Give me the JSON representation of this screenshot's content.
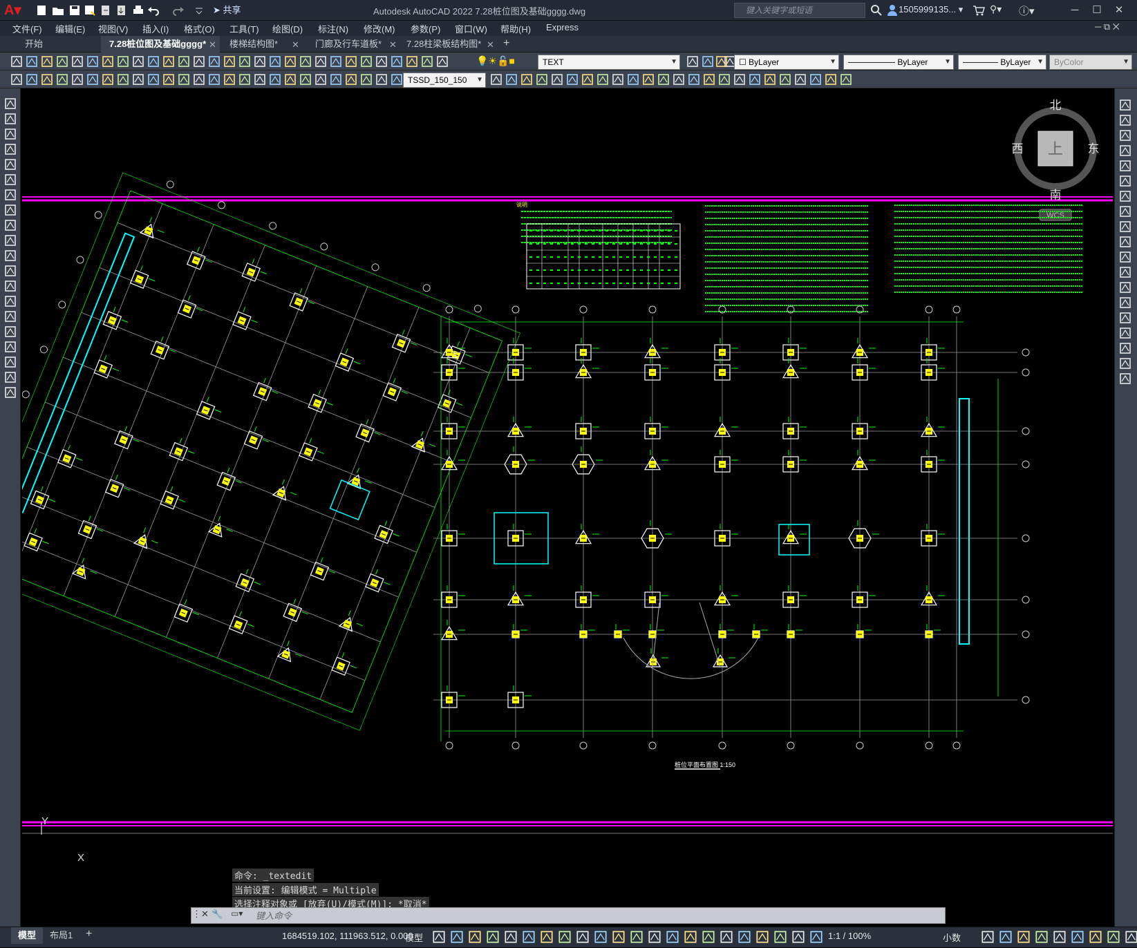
{
  "app": {
    "title": "Autodesk AutoCAD 2022    7.28桩位图及基础gggg.dwg",
    "share_label": "共享",
    "search_placeholder": "键入关键字或短语",
    "user": "1505999135... ▾"
  },
  "menu": [
    "文件(F)",
    "编辑(E)",
    "视图(V)",
    "插入(I)",
    "格式(O)",
    "工具(T)",
    "绘图(D)",
    "标注(N)",
    "修改(M)",
    "参数(P)",
    "窗口(W)",
    "帮助(H)",
    "Express"
  ],
  "tabs": [
    {
      "label": "开始",
      "active": false
    },
    {
      "label": "7.28桩位图及基础gggg*",
      "active": true
    },
    {
      "label": "楼梯结构图*",
      "active": false
    },
    {
      "label": "门廊及行车道板*",
      "active": false
    },
    {
      "label": "7.28柱梁板结构图*",
      "active": false
    }
  ],
  "properties": {
    "layer": "TEXT",
    "color": "ByLayer",
    "linetype": "ByLayer",
    "lineweight": "ByLayer",
    "plotstyle": "ByColor",
    "textstyle": "TSSD_150_150"
  },
  "viewcube": {
    "north": "北",
    "south": "南",
    "east": "东",
    "west": "西",
    "top": "上",
    "wcs": "WCS"
  },
  "drawing": {
    "notes_title": "说明",
    "plan_title": "桩位平面布置图 1:150"
  },
  "ucs": {
    "x": "X",
    "y": "Y"
  },
  "command": {
    "history": [
      "命令: _textedit",
      "当前设置: 编辑模式 = Multiple",
      "选择注释对象或 [放弃(U)/模式(M)]: *取消*"
    ],
    "placeholder": "键入命令"
  },
  "layouts": [
    "模型",
    "布局1"
  ],
  "status": {
    "coords": "1684519.102, 111963.512, 0.000",
    "model_label": "模型",
    "scale": "1:1 / 100%",
    "units": "小数"
  },
  "colors": {
    "background": "#000000",
    "magenta": "#ff00ff",
    "green": "#00ff00",
    "yellow": "#ffff00",
    "cyan": "#00ffff",
    "red": "#ff0000",
    "gray": "#b0b0b0"
  }
}
